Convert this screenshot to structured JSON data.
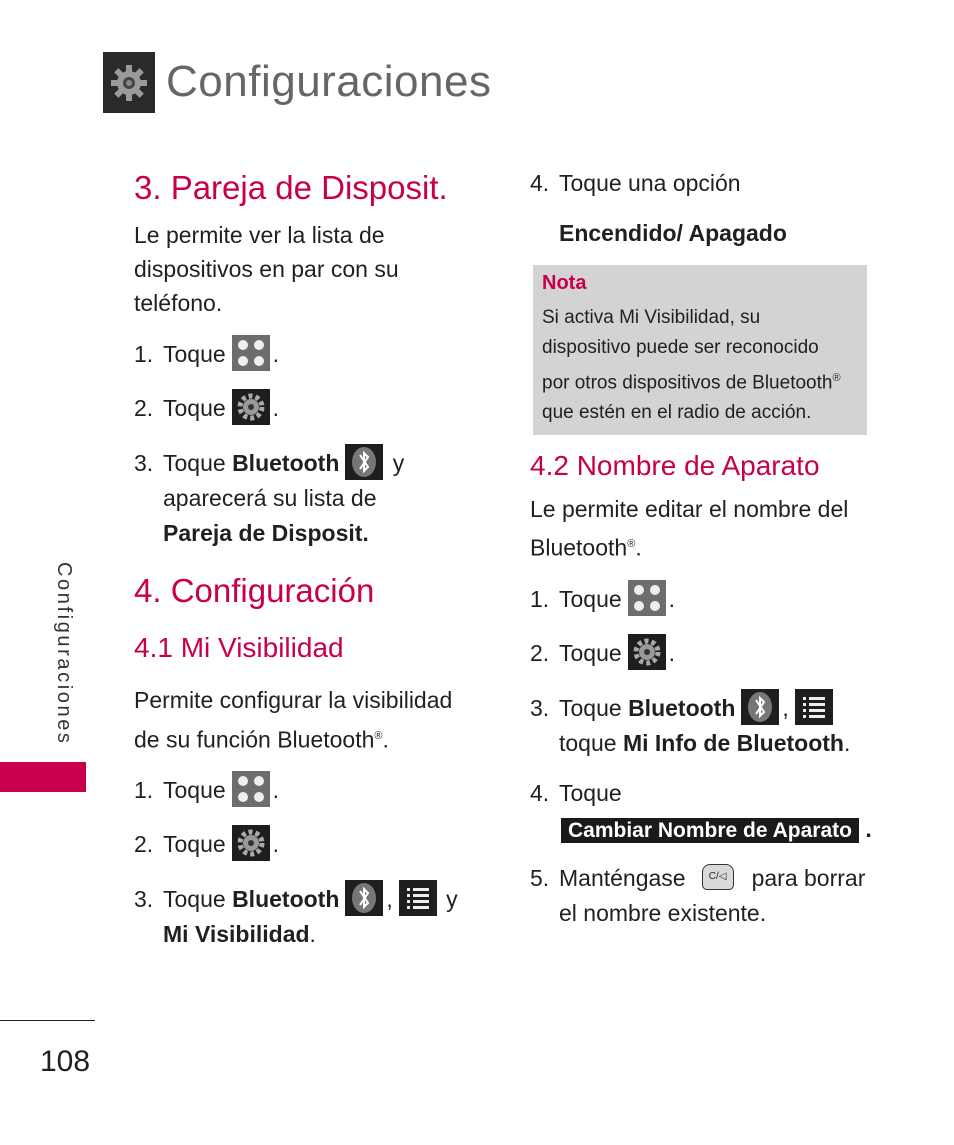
{
  "header": {
    "icon": "gear-icon",
    "title": "Configuraciones"
  },
  "sidebar": {
    "label": "Configuraciones",
    "accent_color": "#c8004b"
  },
  "footer": {
    "page_number": "108"
  },
  "colors": {
    "accent": "#c8004b",
    "note_bg": "#d3d3d3"
  },
  "left": {
    "section3": {
      "title": "3. Pareja de Disposit.",
      "desc": "Le permite ver la lista de dispositivos en par con su teléfono.",
      "steps": [
        {
          "num": "1.",
          "text": "Toque",
          "icon": "menu-grid-icon",
          "after": "."
        },
        {
          "num": "2.",
          "text": "Toque",
          "icon": "settings-gear-icon",
          "after": "."
        },
        {
          "num": "3.",
          "text": "Toque",
          "bold": "Bluetooth",
          "icon": "bluetooth-icon",
          "after": "y",
          "line2": "aparecerá su lista de",
          "line3_bold": "Pareja de Disposit."
        }
      ]
    },
    "section4": {
      "title": "4. Configuración",
      "sub1": {
        "title": "4.1 Mi Visibilidad",
        "desc_line1": "Permite configurar la visibilidad",
        "desc_line2": "de su función Bluetooth",
        "reg": "®",
        "period": ".",
        "steps": [
          {
            "num": "1.",
            "text": "Toque",
            "icon": "menu-grid-icon",
            "after": "."
          },
          {
            "num": "2.",
            "text": "Toque",
            "icon": "settings-gear-icon",
            "after": "."
          },
          {
            "num": "3.",
            "text": "Toque",
            "bold": "Bluetooth",
            "icon": "bluetooth-icon",
            "comma": ",",
            "icon2": "list-menu-icon",
            "after": "y",
            "line2_bold": "Mi Visibilidad",
            "line2_after": "."
          }
        ]
      }
    }
  },
  "right": {
    "step4": {
      "num": "4.",
      "text": "Toque una opción",
      "option": "Encendido/ Apagado"
    },
    "note": {
      "title": "Nota",
      "line1": "Si activa Mi Visibilidad, su",
      "line2": "dispositivo puede ser reconocido",
      "line3": "por otros dispositivos de Bluetooth",
      "reg": "®",
      "line4": "que estén en el radio de acción."
    },
    "sub2": {
      "title": "4.2 Nombre de Aparato",
      "desc_line1": "Le permite editar el nombre del",
      "desc_line2": "Bluetooth",
      "reg": "®",
      "period": ".",
      "steps": [
        {
          "num": "1.",
          "text": "Toque",
          "icon": "menu-grid-icon",
          "after": "."
        },
        {
          "num": "2.",
          "text": "Toque",
          "icon": "settings-gear-icon",
          "after": "."
        },
        {
          "num": "3.",
          "text": "Toque",
          "bold": "Bluetooth",
          "icon": "bluetooth-icon",
          "comma": ",",
          "icon2": "list-menu-icon",
          "line2": "toque",
          "line2_bold": "Mi Info de Bluetooth",
          "line2_after": "."
        },
        {
          "num": "4.",
          "text": "Toque",
          "button": "Cambiar Nombre de Aparato",
          "after": "."
        },
        {
          "num": "5.",
          "text": "Manténgase",
          "key": "C/◁",
          "key_icon": "clear-key-icon",
          "after": "para borrar",
          "line2": "el nombre existente."
        }
      ]
    }
  }
}
